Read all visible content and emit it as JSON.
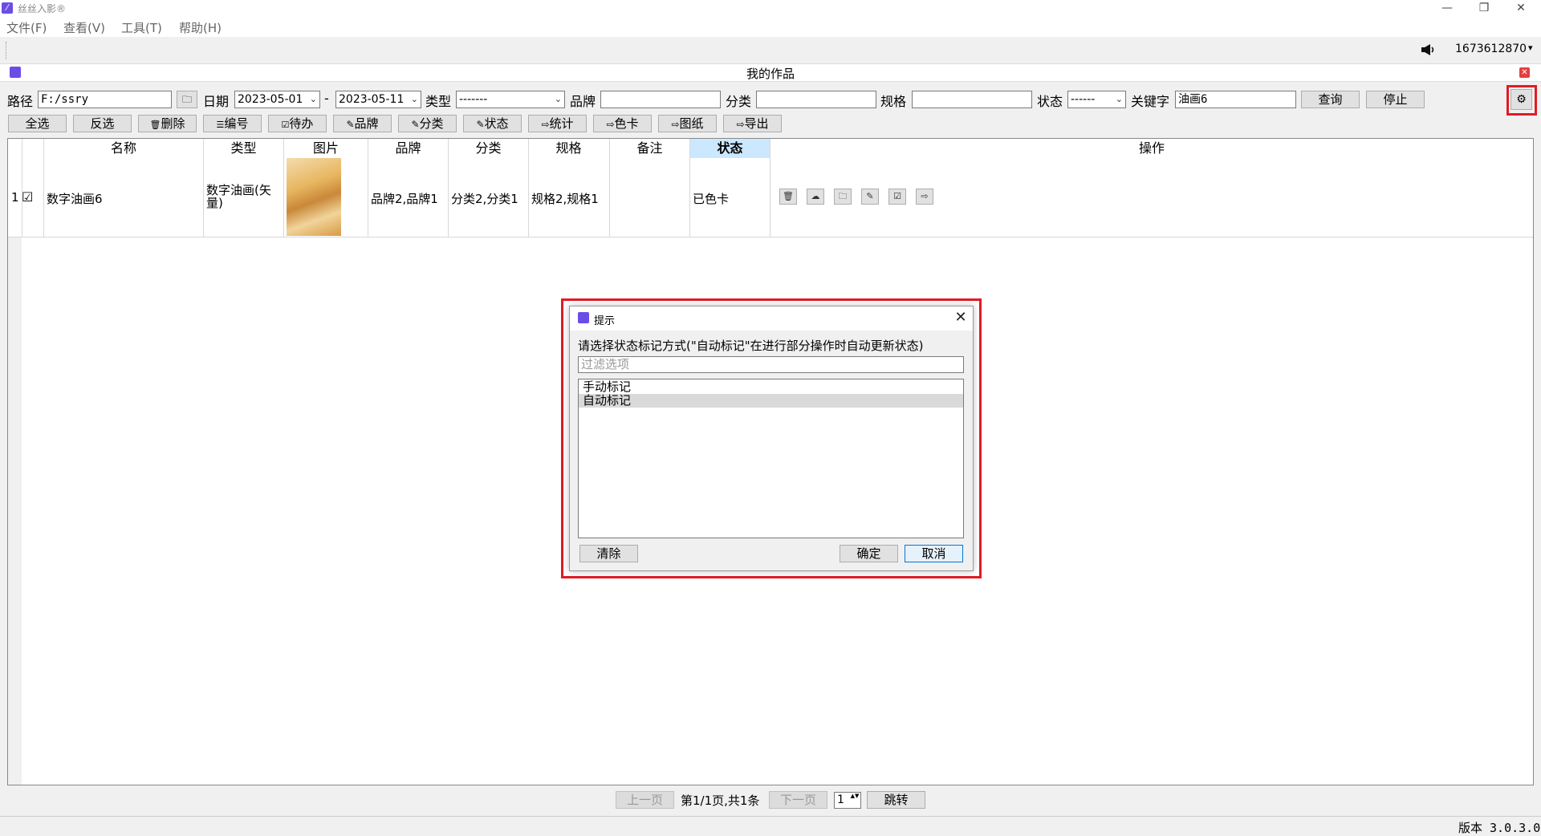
{
  "app": {
    "title": "丝丝入影®"
  },
  "menu": [
    "文件(F)",
    "查看(V)",
    "工具(T)",
    "帮助(H)"
  ],
  "window_controls": {
    "minimize": "—",
    "restore": "❐",
    "close": "✕"
  },
  "account": {
    "user_id": "1673612870",
    "dropdown": "▾"
  },
  "window": {
    "title": "我的作品",
    "close": "✕"
  },
  "filters": {
    "path_label": "路径",
    "path_value": "F:/ssry",
    "date_label": "日期",
    "date_from": "2023-05-01",
    "date_sep": "-",
    "date_to": "2023-05-11",
    "type_label": "类型",
    "type_value": "-------",
    "brand_label": "品牌",
    "brand_value": "",
    "category_label": "分类",
    "category_value": "",
    "spec_label": "规格",
    "spec_value": "",
    "status_label": "状态",
    "status_value": "------",
    "keyword_label": "关键字",
    "keyword_value": "油画6",
    "query_button": "查询",
    "stop_button": "停止",
    "settings_icon": "⚙",
    "folder_icon": "🗀"
  },
  "actions": {
    "select_all": "全选",
    "invert": "反选",
    "delete": "删除",
    "number": "编号",
    "todo": "待办",
    "brand": "品牌",
    "category": "分类",
    "status": "状态",
    "stats": "统计",
    "color_card": "色卡",
    "drawing": "图纸",
    "export": "导出"
  },
  "action_icons": {
    "delete": "🗑",
    "number": "☰",
    "todo": "☑",
    "edit": "✎",
    "export": "⇨"
  },
  "table": {
    "headers": {
      "name": "名称",
      "type": "类型",
      "image": "图片",
      "brand": "品牌",
      "category": "分类",
      "spec": "规格",
      "remark": "备注",
      "status": "状态",
      "ops": "操作"
    },
    "rows": [
      {
        "index": "1",
        "checked": "☑",
        "name": "数字油画6",
        "type": "数字油画(矢量)",
        "brand": "品牌2,品牌1",
        "category": "分类2,分类1",
        "spec": "规格2,规格1",
        "remark": "",
        "status": "已色卡"
      }
    ],
    "op_icons": [
      "🗑",
      "☁",
      "🗀",
      "✎",
      "☑",
      "⇨"
    ]
  },
  "pager": {
    "prev": "上一页",
    "info": "第1/1页,共1条",
    "next": "下一页",
    "page": "1",
    "go": "跳转",
    "spin": "▲▼"
  },
  "statusbar": {
    "version": "版本 3.0.3.0"
  },
  "dialog": {
    "title": "提示",
    "close": "✕",
    "prompt": "请选择状态标记方式(\"自动标记\"在进行部分操作时自动更新状态)",
    "filter_placeholder": "过滤选项",
    "options": [
      {
        "label": "手动标记",
        "selected": false
      },
      {
        "label": "自动标记",
        "selected": true
      }
    ],
    "clear": "清除",
    "ok": "确定",
    "cancel": "取消"
  }
}
